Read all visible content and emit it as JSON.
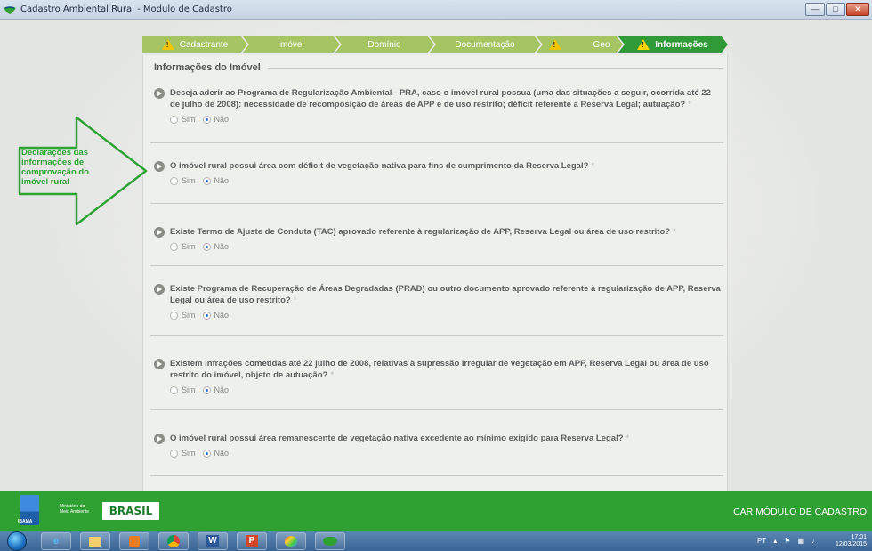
{
  "window": {
    "title": "Cadastro Ambiental Rural - Modulo de Cadastro",
    "buttons": [
      "minimize",
      "maximize",
      "close"
    ]
  },
  "tabs": [
    {
      "label": "Cadastrante",
      "warning": true,
      "active": false
    },
    {
      "label": "Imóvel",
      "warning": false,
      "active": false
    },
    {
      "label": "Domínio",
      "warning": false,
      "active": false
    },
    {
      "label": "Documentação",
      "warning": false,
      "active": false
    },
    {
      "label": "",
      "warning": true,
      "active": false
    },
    {
      "label": "Geo",
      "warning": false,
      "active": false
    },
    {
      "label": "Informações",
      "warning": true,
      "active": true
    }
  ],
  "section": {
    "title": "Informações do Imóvel"
  },
  "questions": [
    {
      "text": "Deseja aderir ao Programa de Regularização Ambiental - PRA, caso o imóvel rural possua (uma das situações a seguir, ocorrida até 22 de julho de 2008): necessidade de recomposição de áreas de APP e de uso restrito; déficit referente a Reserva Legal; autuação?",
      "required": "*",
      "options": [
        "Sim",
        "Não"
      ],
      "selected": "Não"
    },
    {
      "text": "O imóvel rural possui área com déficit de vegetação nativa para fins de cumprimento da Reserva Legal?",
      "required": "*",
      "options": [
        "Sim",
        "Não"
      ],
      "selected": "Não"
    },
    {
      "text": "Existe Termo de Ajuste de Conduta (TAC) aprovado referente à regularização de APP, Reserva Legal ou área de uso restrito?",
      "required": "*",
      "options": [
        "Sim",
        "Não"
      ],
      "selected": "Não"
    },
    {
      "text": "Existe Programa de Recuperação de Áreas Degradadas (PRAD) ou outro documento aprovado referente à regularização de APP, Reserva Legal ou área de uso restrito?",
      "required": "*",
      "options": [
        "Sim",
        "Não"
      ],
      "selected": "Não"
    },
    {
      "text": "Existem infrações cometidas até 22 julho de 2008, relativas à supressão irregular de vegetação em APP, Reserva Legal ou área de uso restrito do imóvel, objeto de autuação?",
      "required": "*",
      "options": [
        "Sim",
        "Não"
      ],
      "selected": "Não"
    },
    {
      "text": "O imóvel rural possui área remanescente de vegetação nativa excedente ao mínimo exigido para Reserva Legal?",
      "required": "*",
      "options": [
        "Sim",
        "Não"
      ],
      "selected": "Não"
    }
  ],
  "callout": {
    "text": "Declarações das informações de comprovação do imóvel rural",
    "color": "#2ea336"
  },
  "footer": {
    "ibama": "IBAMA",
    "ministerio_line1": "Ministério do",
    "ministerio_line2": "Meio Ambiente",
    "brasil": "BRASIL",
    "right_text": "CAR MÓDULO DE CADASTRO"
  },
  "taskbar": {
    "items": [
      "windows-start",
      "internet-explorer",
      "file-explorer",
      "media-player",
      "chrome",
      "word",
      "powerpoint",
      "paint",
      "car-app"
    ],
    "language": "PT",
    "time": "17:01",
    "date": "12/03/2015"
  },
  "colors": {
    "accent": "#2f9a36",
    "tab_inactive": "#a4c561",
    "footer": "#2fa032"
  }
}
